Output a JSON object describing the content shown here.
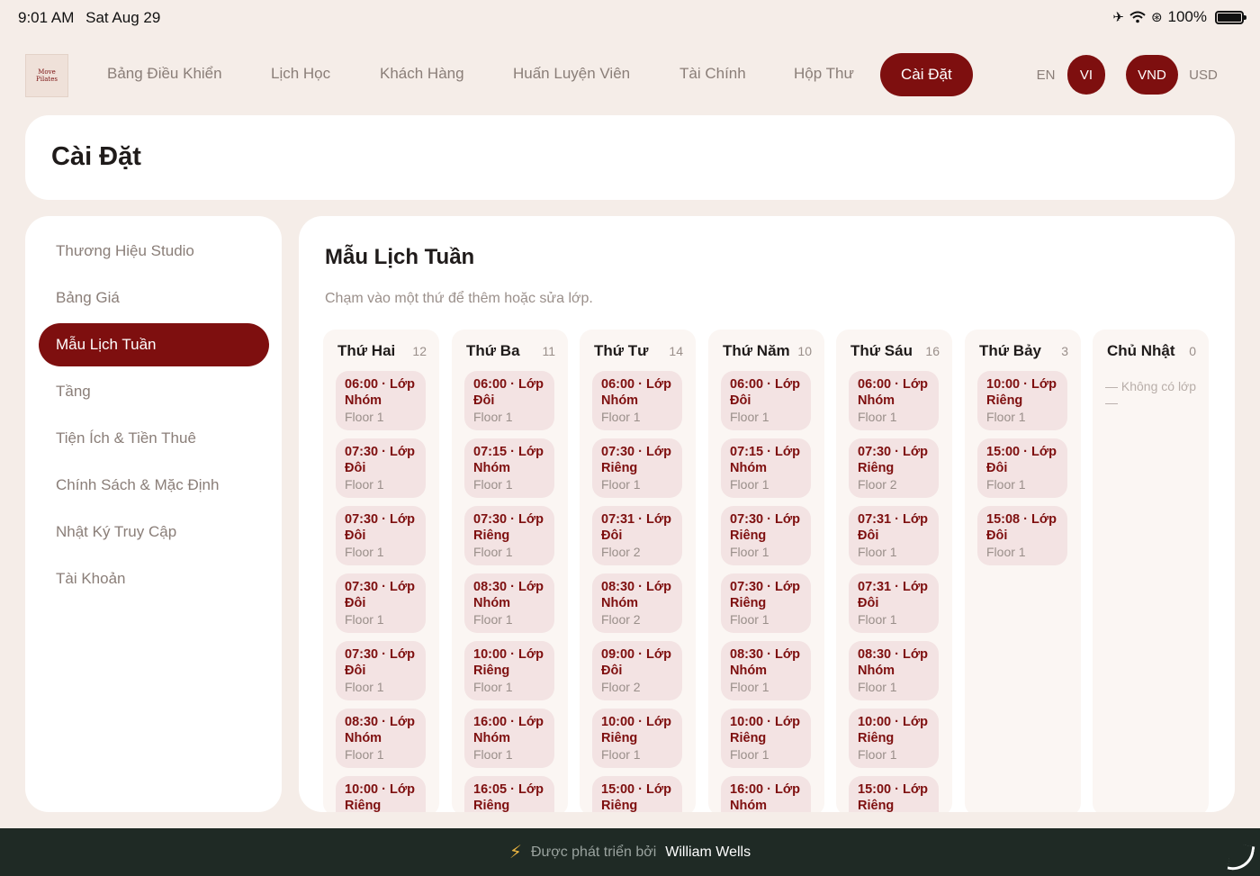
{
  "status_bar": {
    "time": "9:01 AM",
    "date": "Sat Aug 29",
    "battery": "100%",
    "icons": [
      "airplane-icon",
      "wifi-icon",
      "orientation-lock-icon",
      "battery-icon"
    ]
  },
  "brand": {
    "logo_line1": "Move",
    "logo_line2": "Pilates"
  },
  "nav": {
    "items": [
      "Bảng Điều Khiển",
      "Lịch Học",
      "Khách Hàng",
      "Huấn Luyện Viên",
      "Tài Chính",
      "Hộp Thư",
      "Cài Đặt"
    ],
    "active": "Cài Đặt",
    "languages": [
      "EN",
      "VI"
    ],
    "active_language": "VI",
    "currencies": [
      "VND",
      "USD"
    ],
    "active_currency": "VND"
  },
  "page": {
    "title": "Cài Đặt"
  },
  "sidebar": {
    "items": [
      "Thương Hiệu Studio",
      "Bảng Giá",
      "Mẫu Lịch Tuần",
      "Tầng",
      "Tiện Ích & Tiền Thuê",
      "Chính Sách & Mặc Định",
      "Nhật Ký Truy Cập",
      "Tài Khoản"
    ],
    "active": "Mẫu Lịch Tuần"
  },
  "weekly": {
    "title": "Mẫu Lịch Tuần",
    "hint": "Chạm vào một thứ để thêm hoặc sửa lớp.",
    "empty_text": "— Không có lớp —",
    "days": [
      {
        "name": "Thứ Hai",
        "count": "12",
        "slots": [
          {
            "time": "06:00 · Lớp",
            "type": "Nhóm",
            "floor": "Floor 1"
          },
          {
            "time": "07:30 · Lớp",
            "type": "Đôi",
            "floor": "Floor 1"
          },
          {
            "time": "07:30 · Lớp",
            "type": "Đôi",
            "floor": "Floor 1"
          },
          {
            "time": "07:30 · Lớp",
            "type": "Đôi",
            "floor": "Floor 1"
          },
          {
            "time": "07:30 · Lớp",
            "type": "Đôi",
            "floor": "Floor 1"
          },
          {
            "time": "08:30 · Lớp",
            "type": "Nhóm",
            "floor": "Floor 1"
          },
          {
            "time": "10:00 · Lớp",
            "type": "Riêng",
            "floor": ""
          }
        ]
      },
      {
        "name": "Thứ Ba",
        "count": "11",
        "slots": [
          {
            "time": "06:00 · Lớp",
            "type": "Đôi",
            "floor": "Floor 1"
          },
          {
            "time": "07:15 · Lớp",
            "type": "Nhóm",
            "floor": "Floor 1"
          },
          {
            "time": "07:30 · Lớp",
            "type": "Riêng",
            "floor": "Floor 1"
          },
          {
            "time": "08:30 · Lớp",
            "type": "Nhóm",
            "floor": "Floor 1"
          },
          {
            "time": "10:00 · Lớp",
            "type": "Riêng",
            "floor": "Floor 1"
          },
          {
            "time": "16:00 · Lớp",
            "type": "Nhóm",
            "floor": "Floor 1"
          },
          {
            "time": "16:05 · Lớp",
            "type": "Riêng",
            "floor": ""
          }
        ]
      },
      {
        "name": "Thứ Tư",
        "count": "14",
        "slots": [
          {
            "time": "06:00 · Lớp",
            "type": "Nhóm",
            "floor": "Floor 1"
          },
          {
            "time": "07:30 · Lớp",
            "type": "Riêng",
            "floor": "Floor 1"
          },
          {
            "time": "07:31 · Lớp",
            "type": "Đôi",
            "floor": "Floor 2"
          },
          {
            "time": "08:30 · Lớp",
            "type": "Nhóm",
            "floor": "Floor 2"
          },
          {
            "time": "09:00 · Lớp",
            "type": "Đôi",
            "floor": "Floor 2"
          },
          {
            "time": "10:00 · Lớp",
            "type": "Riêng",
            "floor": "Floor 1"
          },
          {
            "time": "15:00 · Lớp",
            "type": "Riêng",
            "floor": ""
          }
        ]
      },
      {
        "name": "Thứ Năm",
        "count": "10",
        "slots": [
          {
            "time": "06:00 · Lớp",
            "type": "Đôi",
            "floor": "Floor 1"
          },
          {
            "time": "07:15 · Lớp",
            "type": "Nhóm",
            "floor": "Floor 1"
          },
          {
            "time": "07:30 · Lớp",
            "type": "Riêng",
            "floor": "Floor 1"
          },
          {
            "time": "07:30 · Lớp",
            "type": "Riêng",
            "floor": "Floor 1"
          },
          {
            "time": "08:30 · Lớp",
            "type": "Nhóm",
            "floor": "Floor 1"
          },
          {
            "time": "10:00 · Lớp",
            "type": "Riêng",
            "floor": "Floor 1"
          },
          {
            "time": "16:00 · Lớp",
            "type": "Nhóm",
            "floor": ""
          }
        ]
      },
      {
        "name": "Thứ Sáu",
        "count": "16",
        "slots": [
          {
            "time": "06:00 · Lớp",
            "type": "Nhóm",
            "floor": "Floor 1"
          },
          {
            "time": "07:30 · Lớp",
            "type": "Riêng",
            "floor": "Floor 2"
          },
          {
            "time": "07:31 · Lớp",
            "type": "Đôi",
            "floor": "Floor 1"
          },
          {
            "time": "07:31 · Lớp",
            "type": "Đôi",
            "floor": "Floor 1"
          },
          {
            "time": "08:30 · Lớp",
            "type": "Nhóm",
            "floor": "Floor 1"
          },
          {
            "time": "10:00 · Lớp",
            "type": "Riêng",
            "floor": "Floor 1"
          },
          {
            "time": "15:00 · Lớp",
            "type": "Riêng",
            "floor": ""
          }
        ]
      },
      {
        "name": "Thứ Bảy",
        "count": "3",
        "slots": [
          {
            "time": "10:00 · Lớp",
            "type": "Riêng",
            "floor": "Floor 1"
          },
          {
            "time": "15:00 · Lớp",
            "type": "Đôi",
            "floor": "Floor 1"
          },
          {
            "time": "15:08 · Lớp",
            "type": "Đôi",
            "floor": "Floor 1"
          }
        ]
      },
      {
        "name": "Chủ Nhật",
        "count": "0",
        "slots": []
      }
    ]
  },
  "footer": {
    "label": "Được phát triển bởi",
    "name": "William Wells"
  },
  "colors": {
    "accent": "#7e0f0f",
    "background": "#f5ede8",
    "slot_bg": "#f3e3e3",
    "footer_bg": "#1f2a25"
  }
}
